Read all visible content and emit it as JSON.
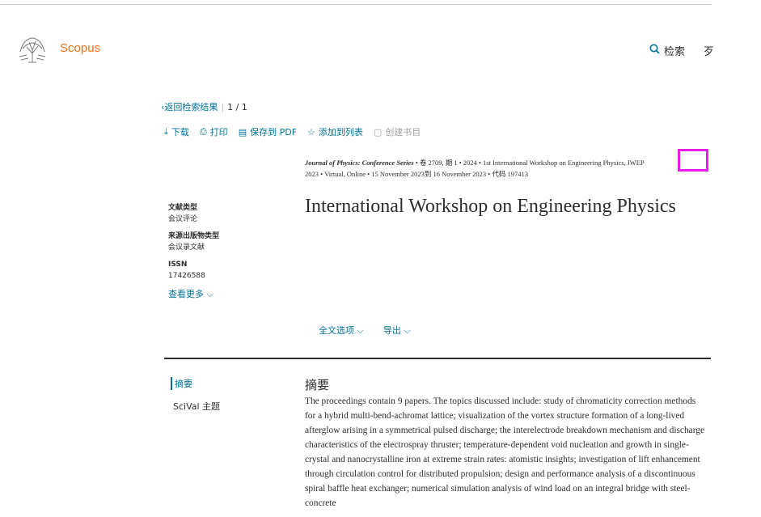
{
  "header": {
    "brand": "Scopus",
    "search_label": "检索",
    "clipped_label": "歹"
  },
  "nav": {
    "back_label": "返回检索结果",
    "pager": "1 / 1"
  },
  "toolbar": {
    "download": "下载",
    "print": "打印",
    "save_pdf": "保存到 PDF",
    "add_list": "添加到列表",
    "bibliography": "创建书目"
  },
  "source": {
    "journal": "Journal of Physics: Conference Series",
    "rest_line1": "• 卷 2709, 期 1 • 2024 • 1st International Workshop on Engineering Physics, IWEP",
    "line2": "2023 • Virtual, Online • 15 November 2023到 16 November 2023 • 代码 197413"
  },
  "title": "International Workshop on Engineering Physics",
  "meta": [
    {
      "label": "文献类型",
      "value": "会议评论"
    },
    {
      "label": "来源出版物类型",
      "value": "会议录文献"
    },
    {
      "label": "ISSN",
      "value": "17426588"
    }
  ],
  "see_more": "查看更多",
  "options": {
    "fulltext": "全文选项",
    "export": "导出"
  },
  "sidenav": {
    "abstract": "摘要",
    "scival": "SciVal 主题"
  },
  "abstract": {
    "heading": "摘要",
    "text": "The proceedings contain 9 papers. The topics discussed include: study of chromaticity correction methods for a hybrid multi-bend-achromat lattice; visualization of the vortex structure formation of a long-lived afterglow arising in a symmetrical pulsed discharge; the interelectrode breakdown mechanism and discharge characteristics of the electrospray thruster; temperature-dependent void nucleation and growth in single-crystal and nanocrystalline iron at extreme strain rates: atomistic insights; investigation of lift enhancement through circulation control for distributed propulsion; design and performance analysis of a discontinuous spiral baffle heat exchanger; numerical simulation analysis of wind load on an integral bridge with steel-concrete"
  },
  "colors": {
    "brand": "#e9711c",
    "link": "#007398",
    "highlight": "#e81ee8"
  }
}
